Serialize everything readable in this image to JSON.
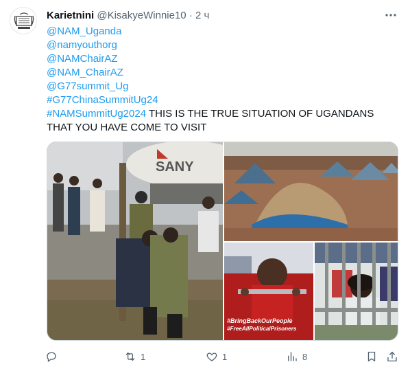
{
  "tweet": {
    "author": {
      "name": "Karietnini",
      "handle": "@KisakyeWinnie10",
      "separator": "·",
      "time": "2 ч"
    },
    "lines": [
      {
        "text": "@NAM_Uganda",
        "kind": "mention"
      },
      {
        "text": "@namyouthorg",
        "kind": "mention"
      },
      {
        "text": "@NAMChairAZ",
        "kind": "mention"
      },
      {
        "text": "@NAM_ChairAZ",
        "kind": "mention"
      },
      {
        "text": "@G77summit_Ug",
        "kind": "mention"
      },
      {
        "text": "#G77ChinaSummitUg24",
        "kind": "hashtag"
      }
    ],
    "last_line": {
      "hashtag": "#NAMSummitUg2024",
      "text": " THIS IS THE TRUE SITUATION OF UGANDANS"
    },
    "final_line": "THAT YOU HAVE COME TO VISIT",
    "media": {
      "photo1_sign": "SANY",
      "photo3_caption_1": "#BringBackOurPeople",
      "photo3_caption_2": "#FreeAllPoliticalPrisoners"
    },
    "actions": {
      "replies": "",
      "reposts": "1",
      "likes": "1",
      "views": "8"
    },
    "colors": {
      "link": "#1d9bf0",
      "text": "#0f1419",
      "muted": "#536471"
    }
  }
}
